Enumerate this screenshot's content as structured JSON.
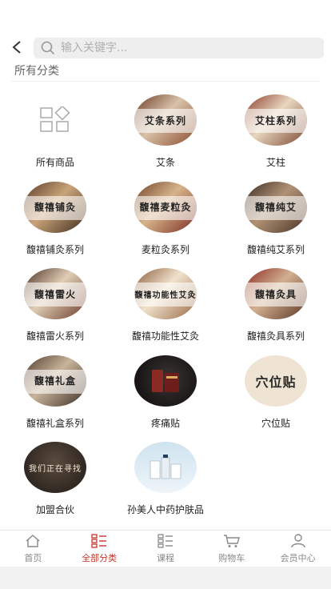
{
  "header": {
    "search_placeholder": "输入关键字..."
  },
  "section_title": "所有分类",
  "categories": [
    {
      "label": "所有商品",
      "img_text": ""
    },
    {
      "label": "艾条",
      "img_text": "艾条系列"
    },
    {
      "label": "艾柱",
      "img_text": "艾柱系列"
    },
    {
      "label": "馥禧铺灸系列",
      "img_text": "馥禧铺灸"
    },
    {
      "label": "麦粒灸系列",
      "img_text": "馥禧麦粒灸"
    },
    {
      "label": "馥禧纯艾系列",
      "img_text": "馥禧纯艾"
    },
    {
      "label": "馥禧雷火系列",
      "img_text": "馥禧雷火"
    },
    {
      "label": "馥禧功能性艾灸",
      "img_text": "馥禧功能性艾灸"
    },
    {
      "label": "馥禧灸具系列",
      "img_text": "馥禧灸具"
    },
    {
      "label": "馥禧礼盒系列",
      "img_text": "馥禧礼盒"
    },
    {
      "label": "疼痛贴",
      "img_text": ""
    },
    {
      "label": "穴位贴",
      "img_text": "穴位贴"
    },
    {
      "label": "加盟合伙",
      "img_text": "我们正在寻找"
    },
    {
      "label": "孙美人中药护肤品",
      "img_text": ""
    }
  ],
  "tabs": [
    {
      "label": "首页",
      "icon": "home-icon"
    },
    {
      "label": "全部分类",
      "icon": "category-icon"
    },
    {
      "label": "课程",
      "icon": "course-icon"
    },
    {
      "label": "购物车",
      "icon": "cart-icon"
    },
    {
      "label": "会员中心",
      "icon": "user-icon"
    }
  ],
  "colors": {
    "active": "#c0392b",
    "inactive": "#888888",
    "search_bg": "#eeeeee"
  }
}
